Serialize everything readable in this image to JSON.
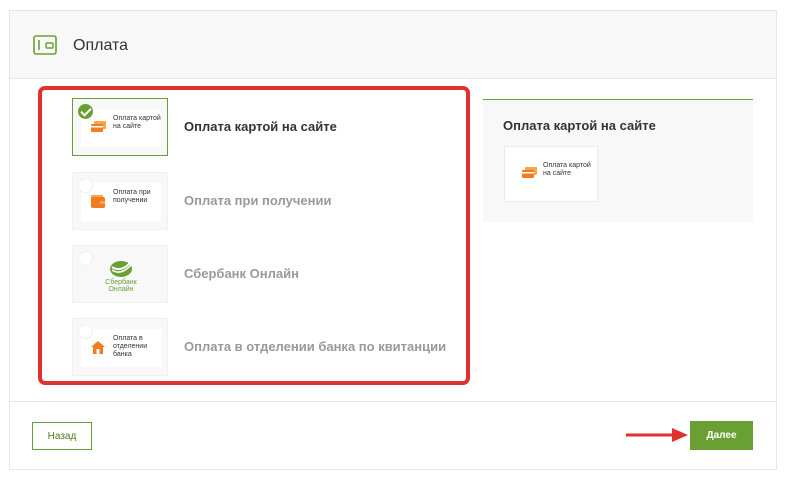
{
  "panel": {
    "title": "Оплата",
    "icon": "wallet-icon"
  },
  "payment_methods": [
    {
      "label": "Оплата картой на сайте",
      "thumb_text": "Оплата картой на сайте",
      "icon": "credit-card-icon",
      "selected": true
    },
    {
      "label": "Оплата при получении",
      "thumb_text": "Оплата при получении",
      "icon": "wallet-icon",
      "selected": false
    },
    {
      "label": "Сбербанк Онлайн",
      "thumb_text": "Сбербанк Онлайн",
      "icon": "sberbank-logo",
      "selected": false
    },
    {
      "label": "Оплата в отделении банка по квитанции",
      "thumb_text": "Оплата в отделении банка",
      "icon": "house-icon",
      "selected": false
    }
  ],
  "summary": {
    "title": "Оплата картой на сайте",
    "card_text": "Оплата картой на сайте",
    "icon": "credit-card-icon"
  },
  "footer": {
    "back_label": "Назад",
    "next_label": "Далее"
  },
  "colors": {
    "accent": "#6aa033",
    "highlight_frame": "#e03131",
    "icon_orange": "#f07d22"
  }
}
